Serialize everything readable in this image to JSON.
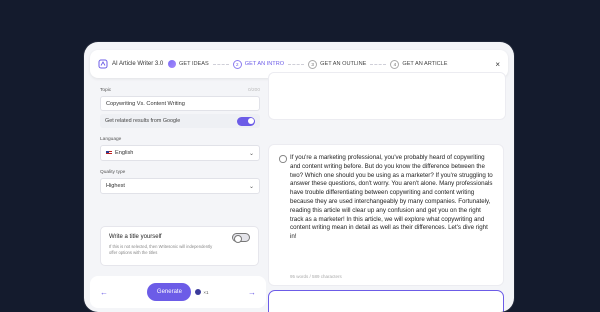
{
  "header": {
    "app_title": "AI Article Writer 3.0",
    "steps": [
      {
        "num": "",
        "label": "GET IDEAS",
        "state": "done"
      },
      {
        "num": "2",
        "label": "GET AN INTRO",
        "state": "active"
      },
      {
        "num": "3",
        "label": "GET AN OUTLINE",
        "state": "pending"
      },
      {
        "num": "4",
        "label": "GET AN ARTICLE",
        "state": "pending"
      }
    ],
    "close_label": "×"
  },
  "form": {
    "topic_label": "Topic",
    "topic_counter": "0/200",
    "topic_value": "Copywriting Vs. Content Writing",
    "related_label": "Get related results from Google",
    "related_on": true,
    "language_label": "Language",
    "language_value": "English",
    "quality_label": "Quality type",
    "quality_value": "Highest"
  },
  "title_card": {
    "title": "Write a title yourself",
    "description": "If this is not selected, then Writesonic will independently offer options with the titles",
    "toggle_on": false
  },
  "bottom_bar": {
    "generate_label": "Generate",
    "credits": "×1"
  },
  "intro_card": {
    "text": "If you're a marketing professional, you've probably heard of copywriting and content writing before. But do you know the difference between the two? Which one should you be using as a marketer? If you're struggling to answer these questions, don't worry. You aren't alone. Many professionals have trouble differentiating between copywriting and content writing because they are used interchangeably by many companies. Fortunately, reading this article will clear up any confusion and get you on the right track as a marketer! In this article, we will explore what copywriting and content writing mean in detail as well as their differences. Let's dive right in!",
    "count": "95 words / 589 characters"
  },
  "colors": {
    "accent": "#6c5ce7",
    "background": "#141b2d"
  }
}
